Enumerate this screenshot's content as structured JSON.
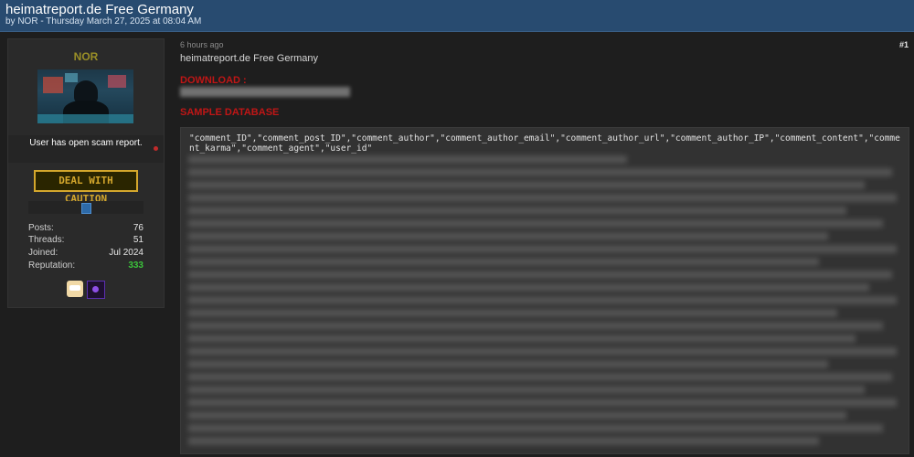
{
  "thread": {
    "title": "heimatreport.de Free Germany",
    "byline": "by NOR - Thursday March 27, 2025 at 08:04 AM"
  },
  "user": {
    "name": "NOR",
    "scam_notice": "User has open scam report.",
    "caution_badge": "DEAL WITH CAUTION",
    "stats": [
      {
        "label": "Posts:",
        "value": "76"
      },
      {
        "label": "Threads:",
        "value": "51"
      },
      {
        "label": "Joined:",
        "value": "Jul 2024"
      },
      {
        "label": "Reputation:",
        "value": "333"
      }
    ],
    "colors": {
      "username": "#9a8f27",
      "reputation": "#3bc23b",
      "scam_dot": "#c12b2b"
    }
  },
  "post": {
    "time": "6 hours ago",
    "number": "#1",
    "title": "heimatreport.de Free Germany",
    "download_label": "DOWNLOAD :",
    "sample_label": "SAMPLE DATABASE",
    "code_header": "\"comment_ID\",\"comment_post_ID\",\"comment_author\",\"comment_author_email\",\"comment_author_url\",\"comment_author_IP\",\"comment_content\",\"comment_karma\",\"comment_agent\",\"user_id\""
  },
  "colors": {
    "header_bg": "#284b70",
    "page_bg": "#1e1e1e",
    "accent_red": "#c01616",
    "caution_gold": "#d4a72c"
  }
}
